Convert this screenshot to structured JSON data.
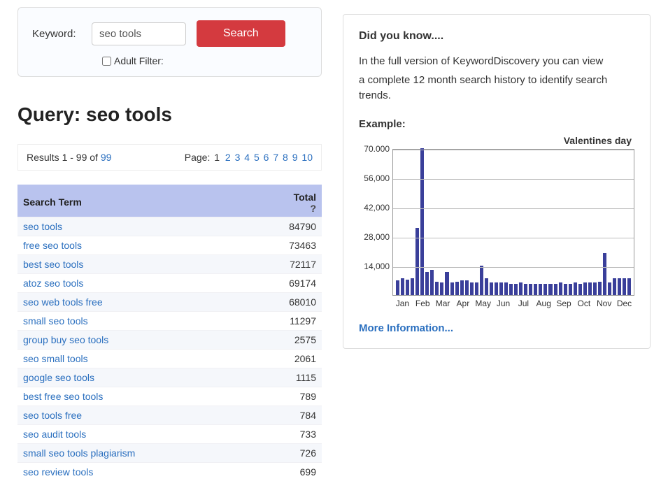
{
  "search": {
    "keyword_label": "Keyword:",
    "keyword_value": "seo tools",
    "button_label": "Search",
    "adult_filter_label": "Adult Filter:"
  },
  "query": {
    "title": "Query: seo tools",
    "results_text_a": "Results 1 - 99 of ",
    "results_total": "99",
    "page_label": "Page: ",
    "current_page": "1",
    "pages": [
      "2",
      "3",
      "4",
      "5",
      "6",
      "7",
      "8",
      "9",
      "10"
    ]
  },
  "table": {
    "col_term": "Search Term",
    "col_total": "Total",
    "qmark": "?",
    "rows": [
      {
        "term": "seo tools",
        "total": "84790"
      },
      {
        "term": "free seo tools",
        "total": "73463"
      },
      {
        "term": "best seo tools",
        "total": "72117"
      },
      {
        "term": "atoz seo tools",
        "total": "69174"
      },
      {
        "term": "seo web tools free",
        "total": "68010"
      },
      {
        "term": "small seo tools",
        "total": "11297"
      },
      {
        "term": "group buy seo tools",
        "total": "2575"
      },
      {
        "term": "seo small tools",
        "total": "2061"
      },
      {
        "term": "google seo tools",
        "total": "1115"
      },
      {
        "term": "best free seo tools",
        "total": "789"
      },
      {
        "term": "seo tools free",
        "total": "784"
      },
      {
        "term": "seo audit tools",
        "total": "733"
      },
      {
        "term": "small seo tools plagiarism",
        "total": "726"
      },
      {
        "term": "seo review tools",
        "total": "699"
      }
    ]
  },
  "info": {
    "heading": "Did you know....",
    "line1": "In the full version of KeywordDiscovery you can view",
    "line2": "a complete 12 month search history to identify search trends.",
    "example_label": "Example:",
    "chart_title": "Valentines day",
    "more_link": "More Information..."
  },
  "chart_data": {
    "type": "bar",
    "title": "Valentines day",
    "xlabel": "",
    "ylabel": "",
    "ylim": [
      0,
      70000
    ],
    "yticks": [
      14000,
      28000,
      42000,
      56000,
      70000
    ],
    "ytick_labels": [
      "14,000",
      "28,000",
      "42,000",
      "56,000",
      "70.000"
    ],
    "month_labels": [
      "Jan",
      "Feb",
      "Mar",
      "Apr",
      "May",
      "Jun",
      "Jul",
      "Aug",
      "Sep",
      "Oct",
      "Nov",
      "Dec"
    ],
    "values": [
      7000,
      8000,
      7500,
      8000,
      32000,
      70000,
      11000,
      12000,
      6500,
      6000,
      11000,
      6000,
      6500,
      7000,
      7000,
      6000,
      6000,
      14000,
      8000,
      6000,
      6000,
      6000,
      6000,
      5500,
      5500,
      6000,
      5500,
      5500,
      5500,
      5500,
      5500,
      5500,
      5500,
      6000,
      5500,
      5500,
      6000,
      5500,
      6000,
      6000,
      6000,
      6500,
      20000,
      6000,
      8000,
      8000,
      8000,
      8000
    ]
  }
}
